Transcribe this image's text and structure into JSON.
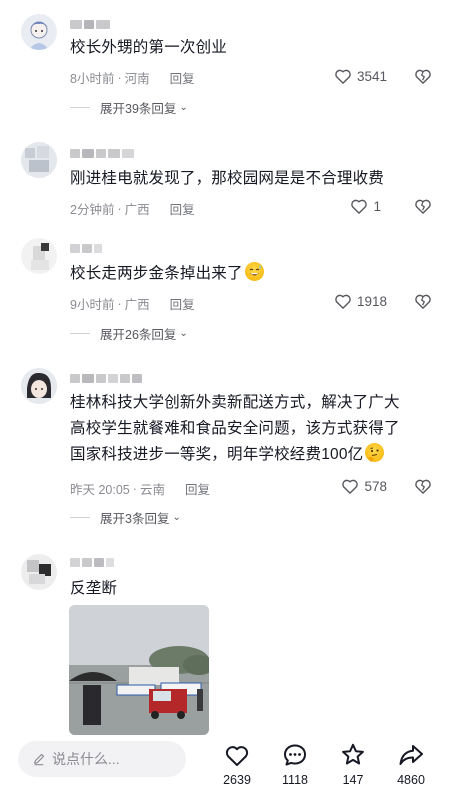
{
  "comments": [
    {
      "text": "校长外甥的第一次创业",
      "time": "8小时前",
      "location": "河南",
      "reply_label": "回复",
      "likes": "3541",
      "expand_label": "展开39条回复"
    },
    {
      "text": "刚进桂电就发现了，那校园网是是不合理收费",
      "time": "2分钟前",
      "location": "广西",
      "reply_label": "回复",
      "likes": "1"
    },
    {
      "text": "校长走两步金条掉出来了",
      "emoji": "grinning-sweat-emoji",
      "time": "9小时前",
      "location": "广西",
      "reply_label": "回复",
      "likes": "1918",
      "expand_label": "展开26条回复"
    },
    {
      "lines": [
        "桂林科技大学创新外卖新配送方式，解决了广大",
        "高校学生就餐难和食品安全问题，该方式获得了",
        "国家科技进步一等奖，明年学校经费100亿"
      ],
      "emoji": "thinking-emoji",
      "time": "昨天 20:05",
      "location": "云南",
      "reply_label": "回复",
      "likes": "578",
      "expand_label": "展开3条回复"
    },
    {
      "text": "反垄断",
      "image": "photo-rainy-campus-gate-with-umbrella-and-banners"
    }
  ],
  "meta_separator": "·",
  "bottom_bar": {
    "input_placeholder": "说点什么...",
    "like_count": "2639",
    "comment_count": "1118",
    "favorite_count": "147",
    "share_count": "4860"
  },
  "icons": {
    "like": "heart-outline-icon",
    "dislike": "broken-heart-icon",
    "comment": "chat-bubble-icon",
    "favorite": "star-outline-icon",
    "share": "share-arrow-icon",
    "input": "pen-icon"
  },
  "colors": {
    "text": "#161823",
    "meta": "#8a8b91",
    "divider": "#d3d3d6",
    "input_bg": "#f2f2f4"
  }
}
